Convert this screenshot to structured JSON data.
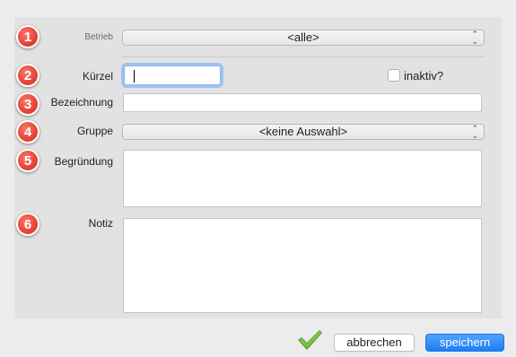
{
  "badges": [
    "1",
    "2",
    "3",
    "4",
    "5",
    "6"
  ],
  "form": {
    "betrieb": {
      "label": "Betrieb",
      "value": "<alle>"
    },
    "kuerzel": {
      "label": "Kürzel",
      "value": ""
    },
    "inaktiv": {
      "label": "inaktiv?",
      "checked": false
    },
    "bezeichnung": {
      "label": "Bezeichnung",
      "value": ""
    },
    "gruppe": {
      "label": "Gruppe",
      "value": "<keine Auswahl>"
    },
    "begruendung": {
      "label": "Begründung",
      "value": ""
    },
    "notiz": {
      "label": "Notiz",
      "value": ""
    }
  },
  "footer": {
    "cancel_label": "abbrechen",
    "save_label": "speichern"
  },
  "colors": {
    "badge": "#e9463a",
    "primary_button": "#2b8cff",
    "checkmark": "#5aa52a"
  },
  "icons": {
    "select_stepper": "up-down-chevron-icon",
    "confirm": "checkmark-icon"
  }
}
